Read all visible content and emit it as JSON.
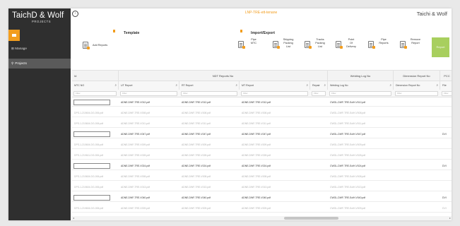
{
  "app": {
    "brand": "TaichD & Wolf",
    "brand_sub": "PROJECTS",
    "brand_right": "Taichi & Wolf",
    "project_title": "LNP-TRE-ett-tenane"
  },
  "sidebar": {
    "items": [
      {
        "icon": "gauge-icon",
        "label": "Manage"
      },
      {
        "icon": "search-icon",
        "label": "Projects"
      }
    ]
  },
  "toolbar": {
    "template_title": "Template",
    "import_export_title": "Import/Export",
    "add_reports": "Add Reports",
    "tools": [
      {
        "id": "pipe",
        "label": "Pipe\nMTC"
      },
      {
        "id": "shipping",
        "label": "Shipping\nPacking\nList"
      },
      {
        "id": "tracks",
        "label": "Tracks\nPacking\nList"
      },
      {
        "id": "point",
        "label": "Point\nOf\nDelivery"
      },
      {
        "id": "pipe_reports",
        "label": "Pipe\nReports"
      },
      {
        "id": "remove",
        "label": "Remove\nReport"
      }
    ],
    "report_button": "Report"
  },
  "grid": {
    "groups": [
      {
        "label": "Id"
      },
      {
        "label": "NDT Reports No"
      },
      {
        "label": "Welding Log No"
      },
      {
        "label": "Dimension Report No"
      },
      {
        "label": "PCC"
      }
    ],
    "columns": [
      {
        "label": "MTC NO"
      },
      {
        "label": "UT Report"
      },
      {
        "label": "RT Report"
      },
      {
        "label": "MT Report"
      },
      {
        "label": "Repair"
      },
      {
        "label": "Welding Log No"
      },
      {
        "label": "Dimension Report No"
      },
      {
        "label": "File"
      }
    ],
    "filter_placeholder": "Filter",
    "rows": [
      {
        "style": "input",
        "cells": [
          "",
          "ADNE-DWF-TRE-V012.pdf",
          "ADNE-DWF-TRE-V012.pdf",
          "ADNE-DWF-TRE-V012.pdf",
          "",
          "CWGL-DWF-TRE-SolH-V012.pdf",
          "",
          ""
        ]
      },
      {
        "style": "dim",
        "cells": [
          "DPS-1-210604-DG-006.pdf",
          "ADNE-DWF-TRE-V008.pdf",
          "ADNE-DWF-TRE-V008.pdf",
          "ADNE-DWF-TRE-V008.pdf",
          "",
          "CWGL-DWF-TRE-SolH-V008.pdf",
          "",
          ""
        ]
      },
      {
        "style": "dim",
        "cells": [
          "DPS-1-210604-DG-006.pdf",
          "ADNE-DWF-TRE-V011.pdf",
          "ADNE-DWF-TRE-V011.pdf",
          "ADNE-DWF-TRE-V011.pdf",
          "",
          "CWGL-DWF-TRE-SolH-V011.pdf",
          "",
          ""
        ]
      },
      {
        "style": "input",
        "cells": [
          "",
          "ADNE-DWF-TRE-V047.pdf",
          "ADNE-DWF-TRE-V047.pdf",
          "ADNE-DWF-TRE-V047.pdf",
          "",
          "CWGL-DWF-TRE-SolH-V047.pdf",
          "",
          "DVI"
        ]
      },
      {
        "style": "dim",
        "cells": [
          "DPS-1-210604-DG-006.pdf",
          "ADNE-DWF-TRE-V009.pdf",
          "ADNE-DWF-TRE-V009.pdf",
          "ADNE-DWF-TRE-V009.pdf",
          "",
          "CWGL-DWF-TRE-SolH-V009.pdf",
          "",
          ""
        ]
      },
      {
        "style": "dim",
        "cells": [
          "DPS-1-210611-DG-006.pdf",
          "ADNE-DWF-TRE-V028.pdf",
          "ADNE-DWF-TRE-V028.pdf",
          "ADNE-DWF-TRE-V028.pdf",
          "",
          "CWGL-DWF-TRE-SolH-V028.pdf",
          "",
          ""
        ]
      },
      {
        "style": "input",
        "cells": [
          "",
          "ADNE-DWF-TRE-V024.pdf",
          "ADNE-DWF-TRE-V024.pdf",
          "ADNE-DWF-TRE-V024.pdf",
          "",
          "CWGL-DWF-TRE-SolH-V024.pdf",
          "",
          "DVI"
        ]
      },
      {
        "style": "dim",
        "cells": [
          "DPS-1-210604-DG-006.pdf",
          "ADNE-DWF-TRE-V008.pdf",
          "ADNE-DWF-TRE-V008.pdf",
          "ADNE-DWF-TRE-V008.pdf",
          "",
          "CWGL-DWF-TRE-SolH-V008.pdf",
          "",
          ""
        ]
      },
      {
        "style": "dim",
        "cells": [
          "DPS-1-210604-DG-006.pdf",
          "ADNE-DWF-TRE-V013.pdf",
          "ADNE-DWF-TRE-V013.pdf",
          "ADNE-DWF-TRE-V013.pdf",
          "",
          "CWGL-DWF-TRE-SolH-V013.pdf",
          "",
          ""
        ]
      },
      {
        "style": "input",
        "cells": [
          "",
          "ADNE-DWF-TRE-V040.pdf",
          "ADNE-DWF-TRE-V040.pdf",
          "ADNE-DWF-TRE-V040.pdf",
          "",
          "CWGL-DWF-TRE-SolH-V040.pdf",
          "",
          "DVI"
        ]
      },
      {
        "style": "dim",
        "cells": [
          "DPS-1-210604-DG-006.pdf",
          "ADNE-DWF-TRE-V009.pdf",
          "ADNE-DWF-TRE-V009.pdf",
          "ADNE-DWF-TRE-V009.pdf",
          "",
          "CWGL-DWF-TRE-SolH-V009.pdf",
          "",
          "DVI"
        ]
      }
    ]
  }
}
